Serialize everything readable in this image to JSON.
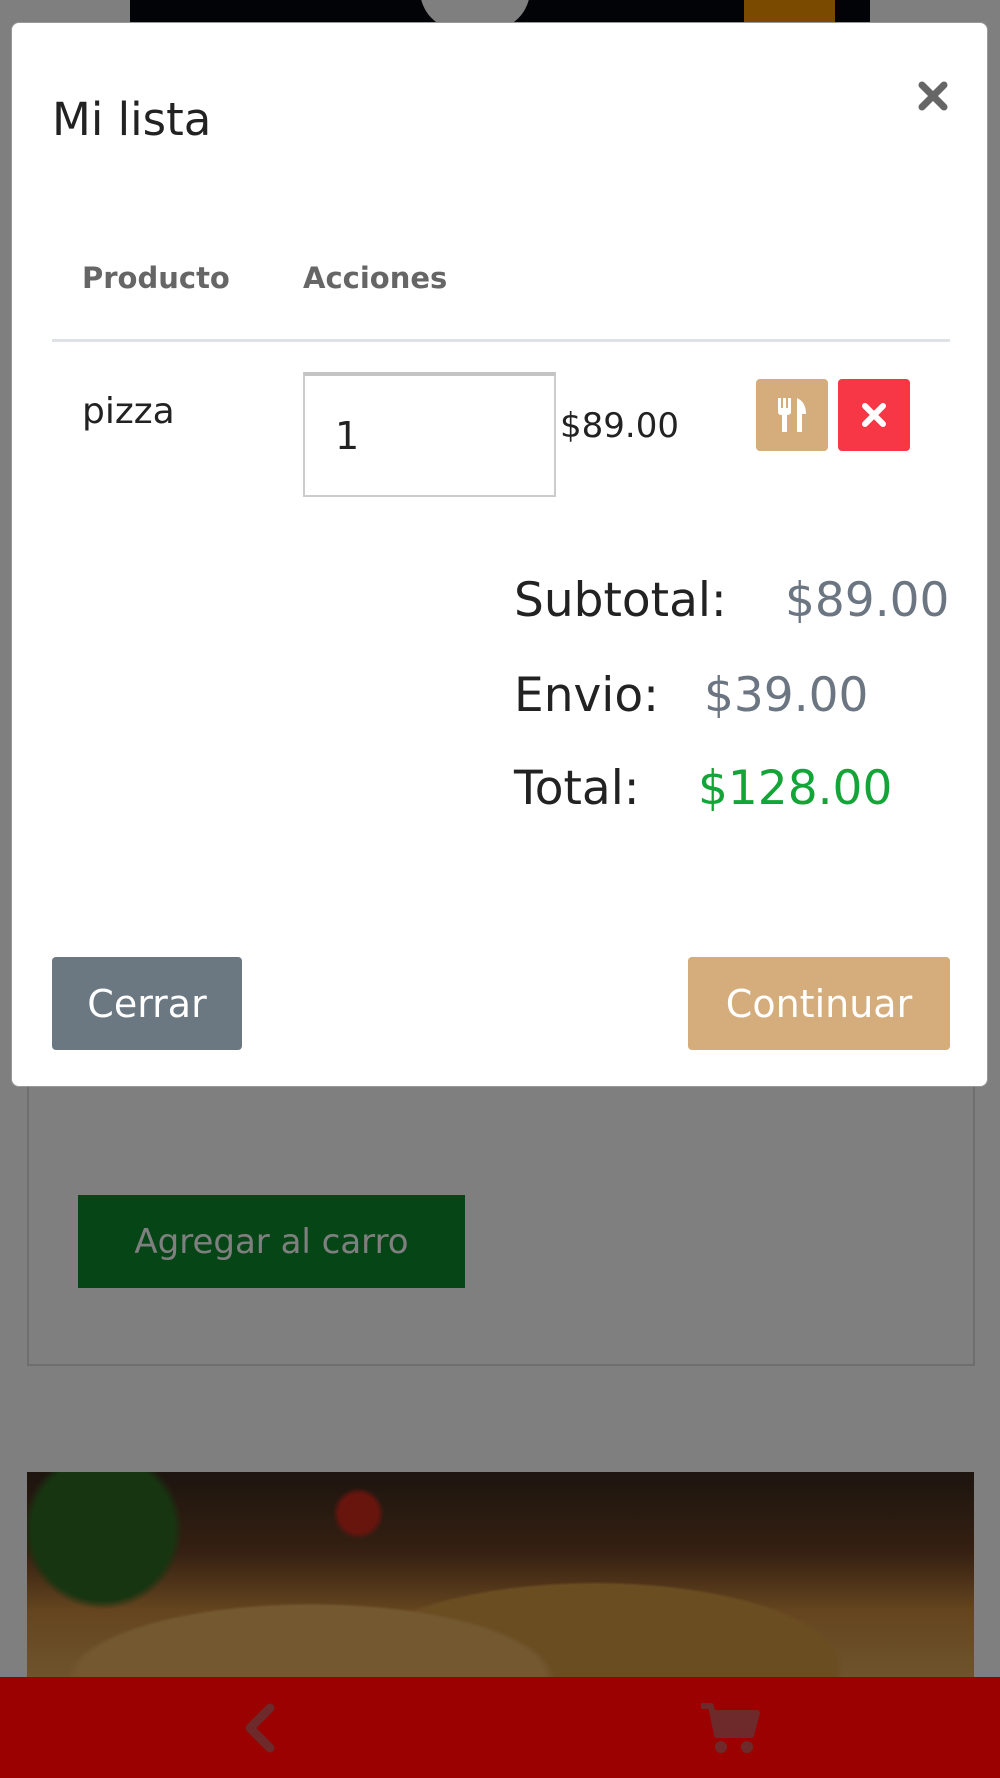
{
  "modal": {
    "title": "Mi lista",
    "columns": [
      "Producto",
      "Acciones"
    ],
    "items": [
      {
        "name": "pizza",
        "quantity": "1",
        "price": "$89.00"
      }
    ],
    "summary": {
      "subtotal_label": "Subtotal:",
      "subtotal_value": "$89.00",
      "shipping_label": "Envio:",
      "shipping_value": "$39.00",
      "total_label": "Total:",
      "total_value": "$128.00"
    },
    "close_label": "Cerrar",
    "continue_label": "Continuar"
  },
  "background": {
    "add_to_cart_label": "Agregar al carro"
  },
  "colors": {
    "accent_tan": "#d5ad7c",
    "danger": "#f73646",
    "total_green": "#13a537",
    "nav_red": "#9a0100",
    "add_button_green": "#0b8a2c"
  },
  "icons": {
    "close": "close-icon",
    "edit_item": "utensils-icon",
    "remove_item": "times-icon",
    "back": "chevron-left-icon",
    "cart": "cart-icon"
  }
}
